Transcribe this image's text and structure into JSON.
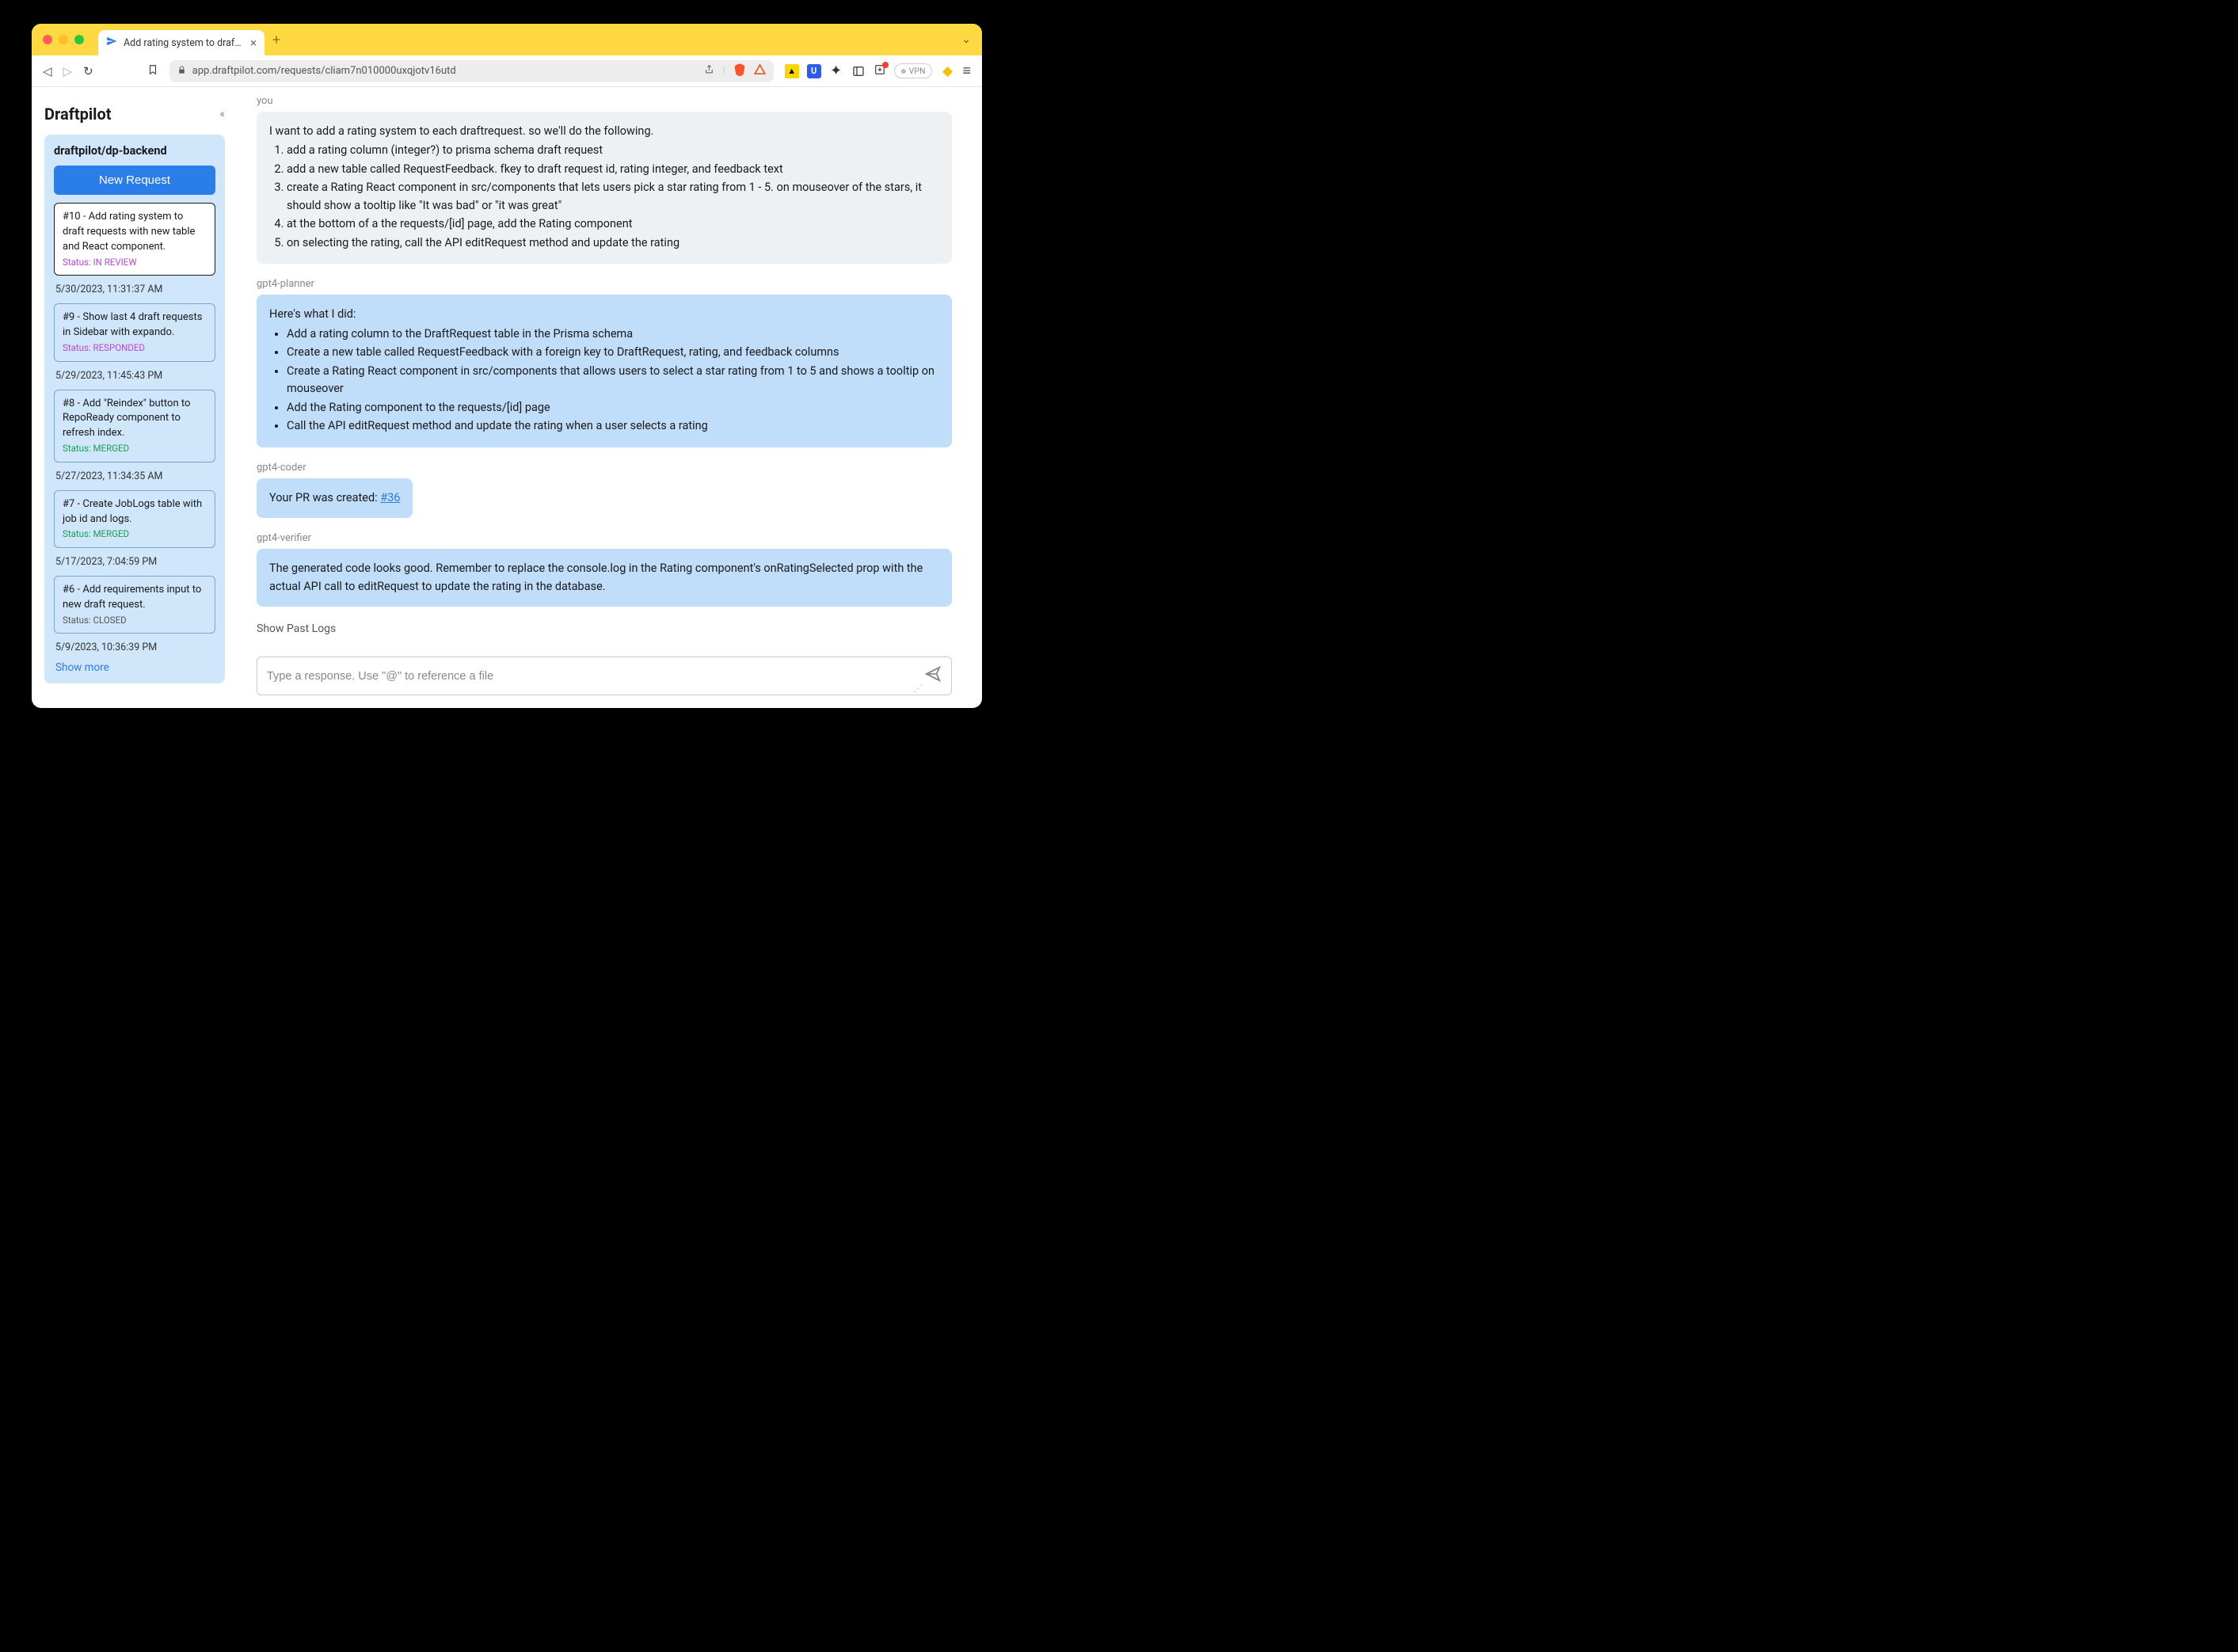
{
  "browser": {
    "tab_title": "Add rating system to draft requ",
    "url": "app.draftpilot.com/requests/cliam7n010000uxqjotv16utd",
    "vpn_label": "VPN"
  },
  "sidebar": {
    "logo": "Draftpilot",
    "repo": "draftpilot/dp-backend",
    "new_request_label": "New Request",
    "requests": [
      {
        "title": "#10 - Add rating system to draft requests with new table and React component.",
        "status_label": "Status: IN REVIEW",
        "status_class": "review"
      },
      {
        "title": "#9 - Show last 4 draft requests in Sidebar with expando.",
        "status_label": "Status: RESPONDED",
        "status_class": "responded"
      },
      {
        "title": "#8 - Add \"Reindex\" button to RepoReady component to refresh index.",
        "status_label": "Status: MERGED",
        "status_class": "merged"
      },
      {
        "title": "#7 - Create JobLogs table with job id and logs.",
        "status_label": "Status: MERGED",
        "status_class": "merged"
      },
      {
        "title": "#6 - Add requirements input to new draft request.",
        "status_label": "Status: CLOSED",
        "status_class": "closed"
      }
    ],
    "timestamps": [
      "5/30/2023, 11:31:37 AM",
      "5/29/2023, 11:45:43 PM",
      "5/27/2023, 11:34:35 AM",
      "5/17/2023, 7:04:59 PM",
      "5/9/2023, 10:36:39 PM"
    ],
    "show_more_label": "Show more"
  },
  "conversation": {
    "user_author": "you",
    "user_intro": "I want to add a rating system to each draftrequest. so we'll do the following.",
    "user_items": [
      "add a rating column (integer?) to prisma schema draft request",
      "add a new table called RequestFeedback. fkey to draft request id, rating integer, and feedback text",
      "create a Rating React component in src/components that lets users pick a star rating from 1 - 5. on mouseover of the stars, it should show a tooltip like \"It was bad\" or \"it was great\"",
      "at the bottom of a the requests/[id] page, add the Rating component",
      "on selecting the rating, call the API editRequest method and update the rating"
    ],
    "planner_author": "gpt4-planner",
    "planner_intro": "Here's what I did:",
    "planner_items": [
      "Add a rating column to the DraftRequest table in the Prisma schema",
      "Create a new table called RequestFeedback with a foreign key to DraftRequest, rating, and feedback columns",
      "Create a Rating React component in src/components that allows users to select a star rating from 1 to 5 and shows a tooltip on mouseover",
      "Add the Rating component to the requests/[id] page",
      "Call the API editRequest method and update the rating when a user selects a rating"
    ],
    "coder_author": "gpt4-coder",
    "coder_text": "Your PR was created: ",
    "coder_pr": "#36",
    "verifier_author": "gpt4-verifier",
    "verifier_text": "The generated code looks good. Remember to replace the console.log in the Rating component's onRatingSelected prop with the actual API call to editRequest to update the rating in the database.",
    "show_logs_label": "Show Past Logs"
  },
  "composer": {
    "placeholder": "Type a response. Use \"@\" to reference a file"
  }
}
